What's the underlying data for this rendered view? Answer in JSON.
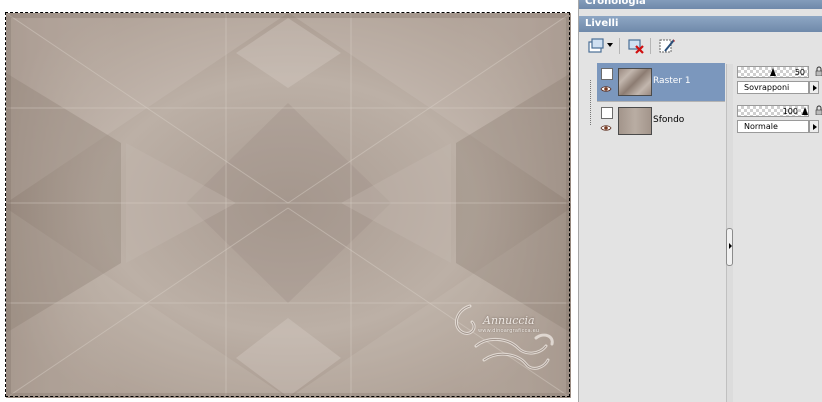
{
  "panels": {
    "history_title": "Cronologia",
    "layers_title": "Livelli"
  },
  "toolbar": {
    "icons": [
      "new-layer-icon",
      "dropdown-arrow-icon",
      "delete-layer-icon",
      "edit-layer-icon"
    ]
  },
  "layers": [
    {
      "name": "Raster 1",
      "selected": true,
      "visible": true,
      "opacity": "50",
      "blend_mode": "Sovrapponi"
    },
    {
      "name": "Sfondo",
      "selected": false,
      "visible": true,
      "opacity": "100",
      "blend_mode": "Normale"
    }
  ],
  "watermark": {
    "name": "Annuccia",
    "url": "www.dinoargraficca.eu"
  },
  "colors": {
    "canvas_tone": "#b3a69c",
    "selected_row": "#7b97bd",
    "title_bar": "#7f98b8"
  }
}
